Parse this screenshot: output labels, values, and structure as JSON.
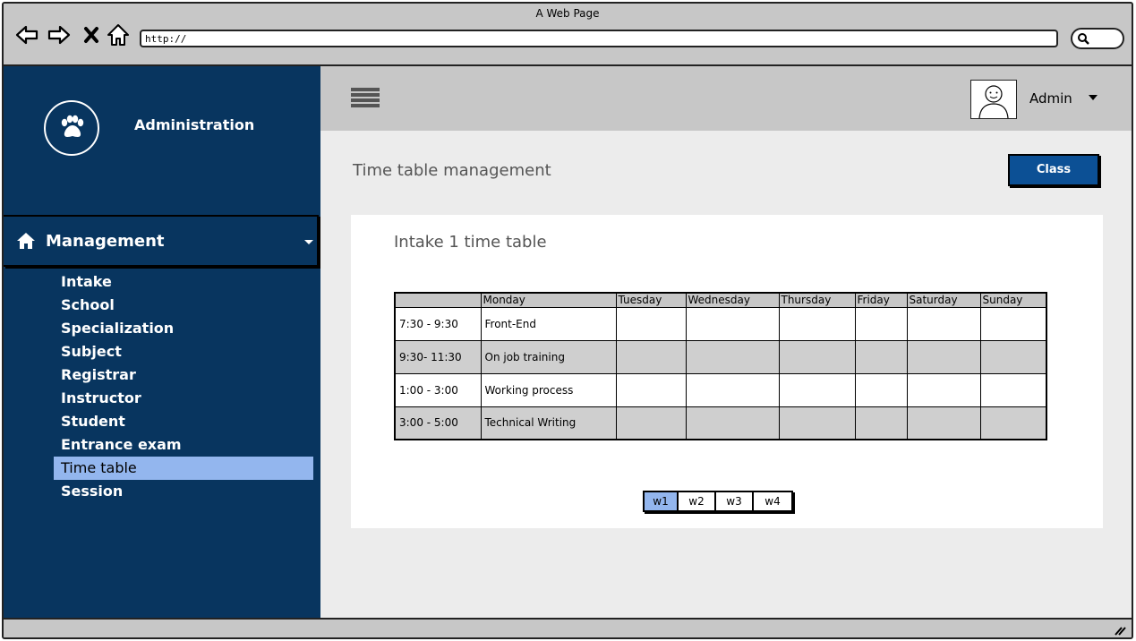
{
  "browser": {
    "title": "A Web Page",
    "url": "http://"
  },
  "sidebar": {
    "brand": "Administration",
    "section_label": "Management",
    "items": [
      {
        "label": "Intake",
        "active": false
      },
      {
        "label": "School",
        "active": false
      },
      {
        "label": "Specialization",
        "active": false
      },
      {
        "label": "Subject",
        "active": false
      },
      {
        "label": "Registrar",
        "active": false
      },
      {
        "label": "Instructor",
        "active": false
      },
      {
        "label": "Student",
        "active": false
      },
      {
        "label": "Entrance exam",
        "active": false
      },
      {
        "label": "Time table",
        "active": true
      },
      {
        "label": "Session",
        "active": false
      }
    ]
  },
  "header": {
    "user_name": "Admin"
  },
  "main": {
    "page_title": "Time table management",
    "class_button": "Class",
    "card_title": "Intake 1 time table",
    "timetable": {
      "columns": [
        "",
        "Monday",
        "Tuesday",
        "Wednesday",
        "Thursday",
        "Friday",
        "Saturday",
        "Sunday"
      ],
      "rows": [
        [
          "7:30 - 9:30",
          "Front-End",
          "",
          "",
          "",
          "",
          "",
          ""
        ],
        [
          "9:30- 11:30",
          "On job training",
          "",
          "",
          "",
          "",
          "",
          ""
        ],
        [
          "1:00 - 3:00",
          "Working process",
          "",
          "",
          "",
          "",
          "",
          ""
        ],
        [
          "3:00 - 5:00",
          "Technical Writing",
          "",
          "",
          "",
          "",
          "",
          ""
        ]
      ]
    },
    "pager": {
      "weeks": [
        "w1",
        "w2",
        "w3",
        "w4"
      ],
      "selected": "w1"
    }
  },
  "colors": {
    "sidebar_bg": "#08355f",
    "active_item": "#93b6ee",
    "primary_button": "#0c5095",
    "chrome": "#c7c7c7",
    "content_bg": "#ececec"
  }
}
